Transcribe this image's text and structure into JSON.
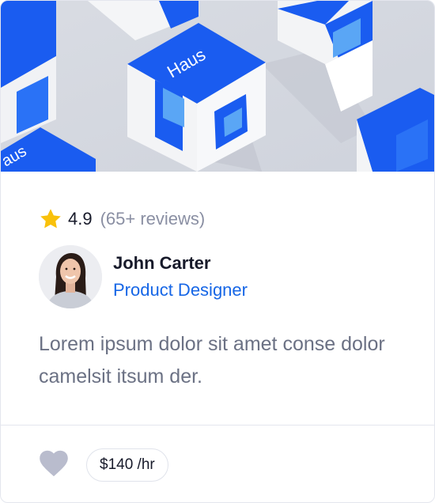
{
  "hero": {
    "box_brand_text": "Haus"
  },
  "rating": {
    "score": "4.9",
    "reviews": "(65+ reviews)"
  },
  "author": {
    "name": "John Carter",
    "role": "Product Designer"
  },
  "description": "Lorem ipsum dolor sit amet conse dolor camelsit itsum der.",
  "footer": {
    "price": "$140 /hr"
  },
  "icons": {
    "star": "star-icon",
    "heart": "heart-icon"
  },
  "colors": {
    "star": "#f9c10b",
    "heart": "#b9bccd",
    "role": "#1666e6",
    "box_blue": "#1a5cf0"
  }
}
